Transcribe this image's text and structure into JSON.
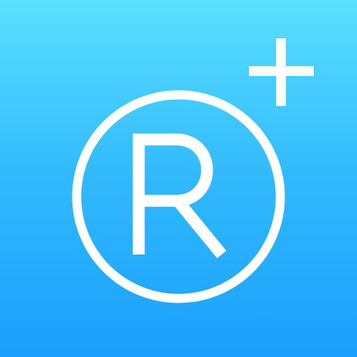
{
  "app_icon": {
    "letter": "R",
    "icons": {
      "ring": "registered-ring-icon",
      "plus": "plus-icon"
    },
    "colors": {
      "gradient_top": "#5ae0fe",
      "gradient_mid": "#31b9fd",
      "gradient_bottom": "#1a9ffc",
      "foreground": "#ffffff"
    }
  }
}
